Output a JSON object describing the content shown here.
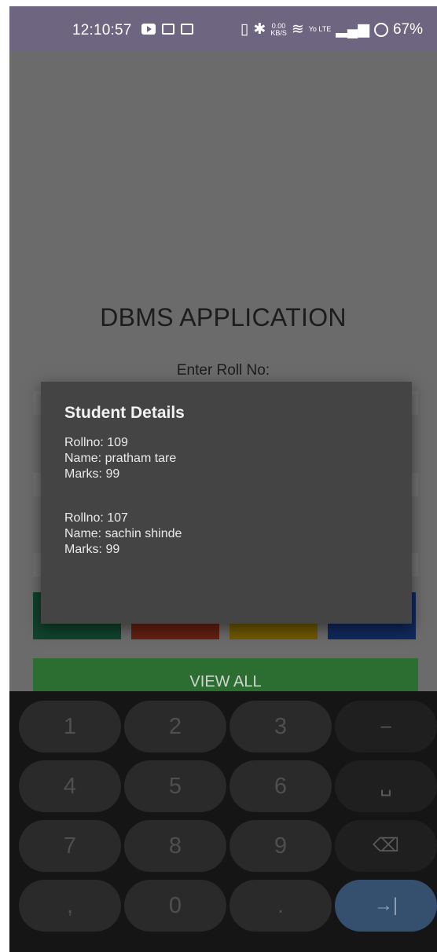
{
  "status_bar": {
    "time": "12:10:57",
    "network_speed_value": "0.00",
    "network_speed_unit": "KB/S",
    "network_type": "Yo LTE",
    "battery": "67%",
    "bg_color": "#6e6680"
  },
  "app": {
    "title": "DBMS APPLICATION",
    "roll_label": "Enter Roll No:",
    "view_all_label": "VIEW ALL",
    "button_colors": [
      "#1f7a52",
      "#b83b20",
      "#c9a100",
      "#1e4ba8"
    ]
  },
  "dialog": {
    "title": "Student Details",
    "records": [
      {
        "rollno": "Rollno: 109",
        "name": "Name: pratham tare",
        "marks": "Marks: 99"
      },
      {
        "rollno": "Rollno: 107",
        "name": "Name: sachin shinde",
        "marks": "Marks: 99"
      }
    ]
  },
  "keyboard": {
    "rows": [
      [
        "1",
        "2",
        "3",
        "–"
      ],
      [
        "4",
        "5",
        "6",
        "␣"
      ],
      [
        "7",
        "8",
        "9",
        "⌫"
      ],
      [
        ",",
        "0",
        ".",
        "→|"
      ]
    ],
    "enter_color": "#34506e"
  }
}
